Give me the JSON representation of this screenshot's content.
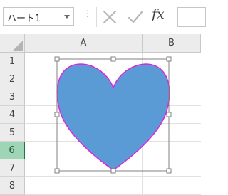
{
  "formula_bar": {
    "name_box_value": "ハート1",
    "formula_value": "",
    "dots_label": "⋮",
    "fx_label": "fx",
    "icons": {
      "cancel": "close-icon",
      "enter": "checkmark-icon",
      "insert_function": "fx-icon",
      "name_box_dropdown": "chevron-down-icon"
    }
  },
  "sheet": {
    "columns": [
      "A",
      "B"
    ],
    "rows": [
      "1",
      "2",
      "3",
      "4",
      "5",
      "6",
      "7",
      "8"
    ],
    "selected_row": "6"
  },
  "shape": {
    "type": "heart",
    "name": "ハート1",
    "fill_color": "#5b9bd5",
    "outline_color": "#e020e0",
    "selection_color": "#808080",
    "selected": true
  },
  "colors": {
    "header_bg": "#ececec",
    "selected_row_bg": "#9fd5b7",
    "selected_row_accent": "#217346",
    "gridline": "#e1e1e1"
  }
}
